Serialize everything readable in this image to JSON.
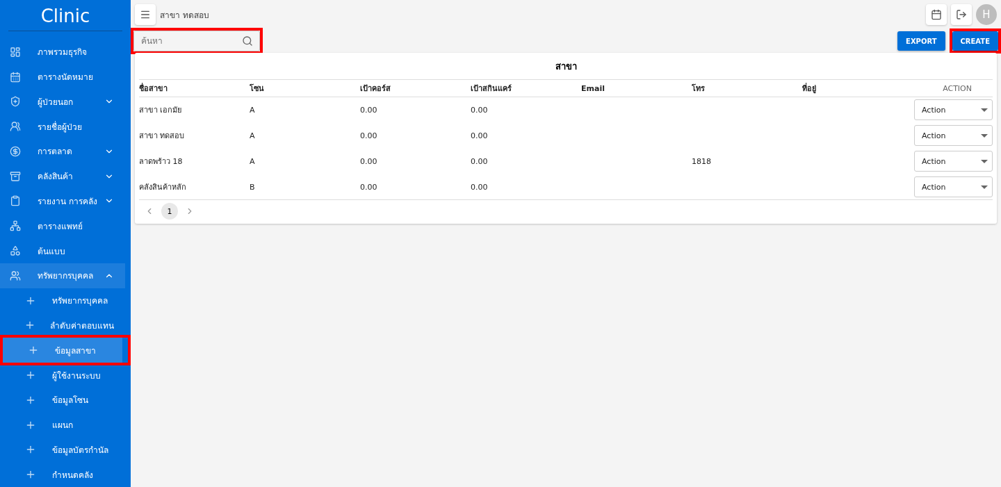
{
  "sidebar": {
    "title": "Clinic",
    "items": [
      {
        "label": "ภาพรวมธุรกิจ",
        "selected": false
      },
      {
        "label": "ตารางนัดหมาย",
        "selected": false
      },
      {
        "label": "ผู้ป่วยนอก",
        "selected": false,
        "expanded": false
      },
      {
        "label": "รายชื่อผู้ป่วย",
        "selected": false
      },
      {
        "label": "การตลาด",
        "selected": false,
        "expanded": false
      },
      {
        "label": "คลังสินค้า",
        "selected": false,
        "expanded": false
      },
      {
        "label": "รายงาน การคลัง",
        "selected": false,
        "expanded": false
      },
      {
        "label": "ตารางแพทย์",
        "selected": false
      },
      {
        "label": "ต้นแบบ",
        "selected": false
      },
      {
        "label": "ทรัพยากรบุคคล",
        "selected": false,
        "expanded": true,
        "children": [
          {
            "label": "ทรัพยากรบุคคล",
            "selected": false,
            "highlighted": false
          },
          {
            "label": "ลำดับค่าตอบแทน",
            "selected": false,
            "highlighted": false
          },
          {
            "label": "ข้อมูลสาขา",
            "selected": true,
            "highlighted": true
          },
          {
            "label": "ผู้ใช้งานระบบ",
            "selected": false,
            "highlighted": false
          },
          {
            "label": "ข้อมูลโซน",
            "selected": false,
            "highlighted": false
          },
          {
            "label": "แผนก",
            "selected": false,
            "highlighted": false
          },
          {
            "label": "ข้อมูลบัตรกำนัล",
            "selected": false,
            "highlighted": false
          },
          {
            "label": "กำหนดคลัง",
            "selected": false,
            "highlighted": false
          }
        ]
      }
    ]
  },
  "topbar": {
    "breadcrumb": "สาขา ทดสอบ",
    "avatar": "H"
  },
  "search": {
    "placeholder": "ค้นหา",
    "highlighted": true
  },
  "buttons": [
    {
      "label": "EXPORT",
      "highlighted": false
    },
    {
      "label": "CREATE",
      "highlighted": true
    }
  ],
  "table": {
    "title": "สาขา",
    "columns": [
      "ชื่อสาขา",
      "โซน",
      "เป้าคอร์ส",
      "เป้าสกินแคร์",
      "Email",
      "โทร",
      "ที่อยู่",
      "ACTION"
    ],
    "rows": [
      {
        "cells": [
          "สาขา เอกมัย",
          "A",
          "0.00",
          "0.00",
          "",
          "",
          "",
          ""
        ],
        "action": "Action"
      },
      {
        "cells": [
          "สาขา ทดสอบ",
          "A",
          "0.00",
          "0.00",
          "",
          "",
          "",
          ""
        ],
        "action": "Action"
      },
      {
        "cells": [
          "ลาดพร้าว 18",
          "A",
          "0.00",
          "0.00",
          "",
          "1818",
          "",
          ""
        ],
        "action": "Action"
      },
      {
        "cells": [
          "คลังสินค้าหลัก",
          "B",
          "0.00",
          "0.00",
          "",
          "",
          "",
          ""
        ],
        "action": "Action"
      }
    ]
  },
  "pagination": {
    "pages": [
      {
        "label": "1",
        "selected": true
      }
    ]
  }
}
